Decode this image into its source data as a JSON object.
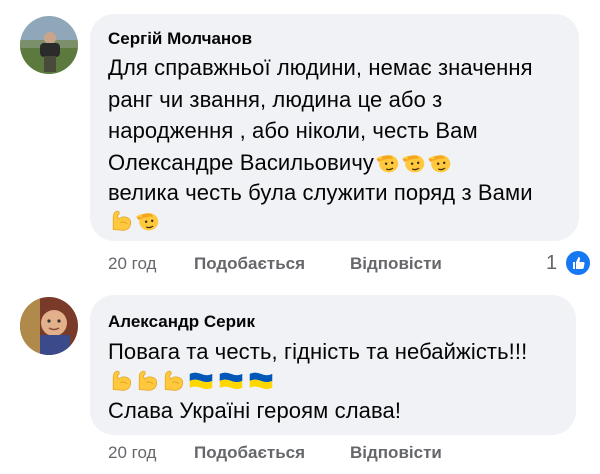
{
  "comments": [
    {
      "author": "Сергій Молчанов",
      "lines": [
        "Для справжньої людини, немає значення",
        "ранг чи звання, людина це або з",
        "народження , або ніколи, честь Вам",
        "Олександре Васильовичу",
        "велика честь була служити поряд з Вами"
      ],
      "line4_emoji": [
        "salute-face-icon",
        "salute-face-icon",
        "salute-face-icon"
      ],
      "line6_emoji": [
        "flexed-biceps-icon",
        "salute-face-icon"
      ],
      "time": "20 год",
      "like_label": "Подобається",
      "reply_label": "Відповісти",
      "reaction_count": "1",
      "reaction_icon": "thumbs-up-icon"
    },
    {
      "author": "Александр Серик",
      "lines": [
        "Повага та честь, гідність та небайжість!!!",
        "Слава Україні героям слава!"
      ],
      "line2_emoji": [
        "flexed-biceps-icon",
        "flexed-biceps-icon",
        "flexed-biceps-icon",
        "ukraine-flag-icon",
        "ukraine-flag-icon",
        "ukraine-flag-icon"
      ],
      "time": "20 год",
      "like_label": "Подобається",
      "reply_label": "Відповісти"
    }
  ],
  "colors": {
    "bubble": "#f0f2f5",
    "meta_text": "#65676b",
    "like_blue": "#1877f2",
    "emoji_yellow": "#ffc83d",
    "flag_blue": "#0057b7",
    "flag_yellow": "#ffd700"
  }
}
